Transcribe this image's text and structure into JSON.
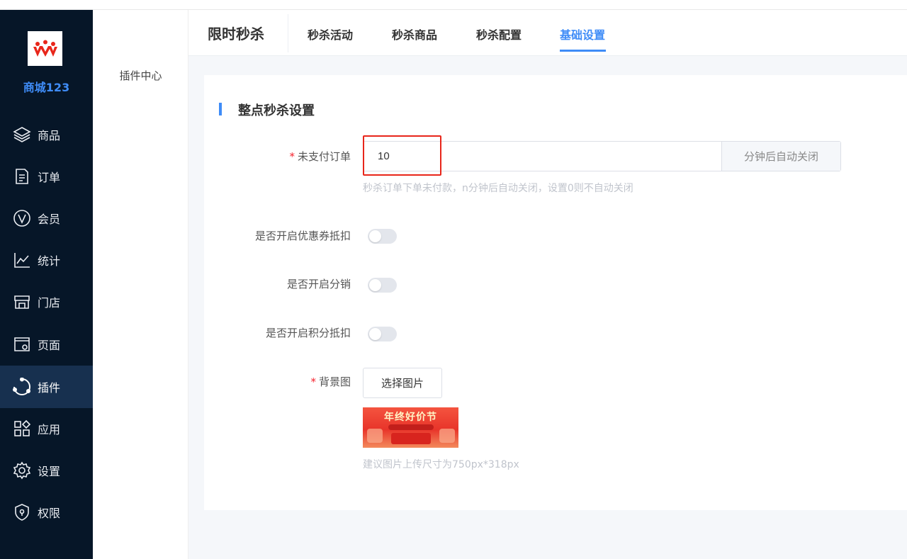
{
  "sidebar": {
    "brand": "商城123",
    "items": [
      {
        "label": "商品",
        "icon": "layers-icon"
      },
      {
        "label": "订单",
        "icon": "document-icon"
      },
      {
        "label": "会员",
        "icon": "vip-icon"
      },
      {
        "label": "统计",
        "icon": "chart-icon"
      },
      {
        "label": "门店",
        "icon": "store-icon"
      },
      {
        "label": "页面",
        "icon": "page-settings-icon"
      },
      {
        "label": "插件",
        "icon": "plugin-icon",
        "active": true
      },
      {
        "label": "应用",
        "icon": "apps-icon"
      },
      {
        "label": "设置",
        "icon": "gear-icon"
      },
      {
        "label": "权限",
        "icon": "shield-icon"
      }
    ]
  },
  "submenu": {
    "items": [
      "插件中心"
    ]
  },
  "header": {
    "title": "限时秒杀",
    "tabs": [
      "秒杀活动",
      "秒杀商品",
      "秒杀配置",
      "基础设置"
    ],
    "active_tab": "基础设置"
  },
  "form": {
    "section_title": "整点秒杀设置",
    "unpaid": {
      "required_mark": "*",
      "label": "未支付订单",
      "value": "10",
      "suffix": "分钟后自动关闭",
      "hint": "秒杀订单下单未付款，n分钟后自动关闭，设置0则不自动关闭"
    },
    "coupon": {
      "label": "是否开启优惠券抵扣",
      "on": false
    },
    "distribution": {
      "label": "是否开启分销",
      "on": false
    },
    "points": {
      "label": "是否开启积分抵扣",
      "on": false
    },
    "background": {
      "required_mark": "*",
      "label": "背景图",
      "button": "选择图片",
      "banner_text": "年终好价节",
      "hint": "建议图片上传尺寸为750px*318px"
    }
  },
  "colors": {
    "sidebar_bg": "#061628",
    "accent": "#3f8cf7",
    "highlight": "#e8261a"
  }
}
